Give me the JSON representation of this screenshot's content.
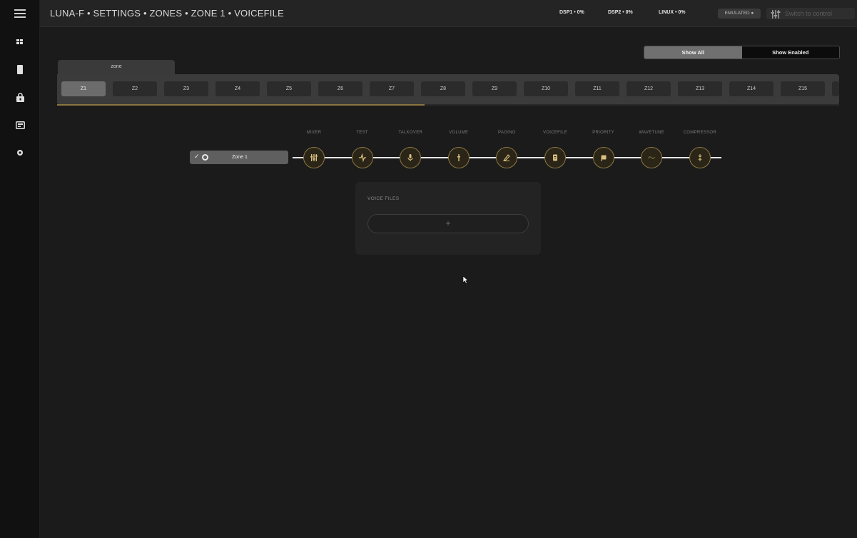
{
  "header": {
    "breadcrumb": "LUNA-F • SETTINGS • ZONES • ZONE 1 • VOICEFILE",
    "stats": [
      "DSP1 • 0%",
      "DSP2 • 0%",
      "LINUX • 0%"
    ],
    "emulated": "EMULATED ●",
    "switch_label": "Switch to control"
  },
  "sidebar": {
    "icons": [
      "menu-icon",
      "grid-icon",
      "device-icon",
      "lock-icon",
      "monitor-icon",
      "settings-icon"
    ]
  },
  "filter": {
    "show_all": "Show All",
    "show_enabled": "Show Enabled",
    "selected": "Show All"
  },
  "zones": {
    "tab_label": "zone",
    "items": [
      "Z1",
      "Z2",
      "Z3",
      "Z4",
      "Z5",
      "Z6",
      "Z7",
      "Z8",
      "Z9",
      "Z10",
      "Z11",
      "Z12",
      "Z13",
      "Z14",
      "Z15"
    ],
    "active": "Z1",
    "scroll_fraction": 0.47
  },
  "chain": {
    "zone_name": "Zone 1",
    "check": "✓",
    "stages": [
      {
        "label": "MIXER",
        "icon": "mixer-icon"
      },
      {
        "label": "TEST",
        "icon": "test-icon"
      },
      {
        "label": "TALKOVER",
        "icon": "microphone-icon"
      },
      {
        "label": "VOLUME",
        "icon": "volume-icon"
      },
      {
        "label": "PAGING",
        "icon": "paging-icon"
      },
      {
        "label": "VOICEFILE",
        "icon": "voicefile-icon"
      },
      {
        "label": "PRIORITY",
        "icon": "priority-icon"
      },
      {
        "label": "WAVETUNE",
        "icon": "wavetune-icon"
      },
      {
        "label": "COMPRESSOR",
        "icon": "compressor-icon"
      }
    ]
  },
  "voice_files": {
    "title": "VOICE FILES",
    "add": "+"
  },
  "colors": {
    "accent": "#8c7646",
    "background": "#1b1b1b",
    "sidebar": "#111111"
  }
}
